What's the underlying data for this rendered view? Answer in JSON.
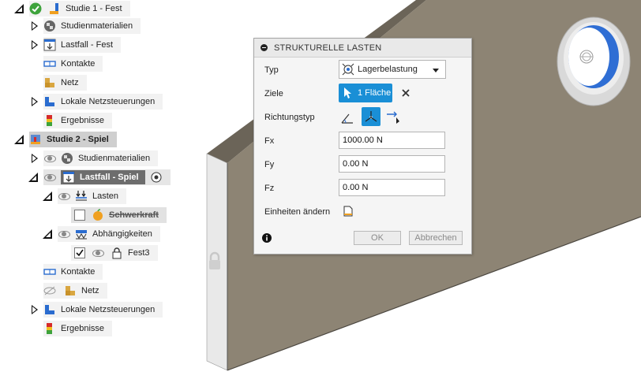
{
  "browser": {
    "study1": {
      "label": "Studie 1 - Fest"
    },
    "s1_materials": {
      "label": "Studienmaterialien"
    },
    "s1_loadcase": {
      "label": "Lastfall - Fest"
    },
    "s1_contacts": {
      "label": "Kontakte"
    },
    "s1_mesh": {
      "label": "Netz"
    },
    "s1_local_mesh": {
      "label": "Lokale Netzsteuerungen"
    },
    "s1_results": {
      "label": "Ergebnisse"
    },
    "study2": {
      "label": "Studie 2 - Spiel"
    },
    "s2_materials": {
      "label": "Studienmaterialien"
    },
    "s2_loadcase": {
      "label": "Lastfall - Spiel"
    },
    "s2_loads": {
      "label": "Lasten"
    },
    "s2_gravity": {
      "label": "Schwerkraft"
    },
    "s2_constraints": {
      "label": "Abhängigkeiten"
    },
    "s2_fixed3": {
      "label": "Fest3"
    },
    "s2_contacts": {
      "label": "Kontakte"
    },
    "s2_mesh": {
      "label": "Netz"
    },
    "s2_local_mesh": {
      "label": "Lokale Netzsteuerungen"
    },
    "s2_results": {
      "label": "Ergebnisse"
    }
  },
  "dialog": {
    "title": "STRUKTURELLE LASTEN",
    "type_label": "Typ",
    "type_value": "Lagerbelastung",
    "targets_label": "Ziele",
    "targets_value": "1 Fläche",
    "direction_label": "Richtungstyp",
    "fx_label": "Fx",
    "fx_value": "1000.00 N",
    "fy_label": "Fy",
    "fy_value": "0.00 N",
    "fz_label": "Fz",
    "fz_value": "0.00 N",
    "units_label": "Einheiten ändern",
    "ok_label": "OK",
    "cancel_label": "Abbrechen"
  },
  "colors": {
    "part_face": "#8c8373",
    "part_top": "#6e675b",
    "part_front": "#e6e6e6",
    "hole_blue": "#2f6ed4",
    "accent": "#1a8fd6"
  }
}
